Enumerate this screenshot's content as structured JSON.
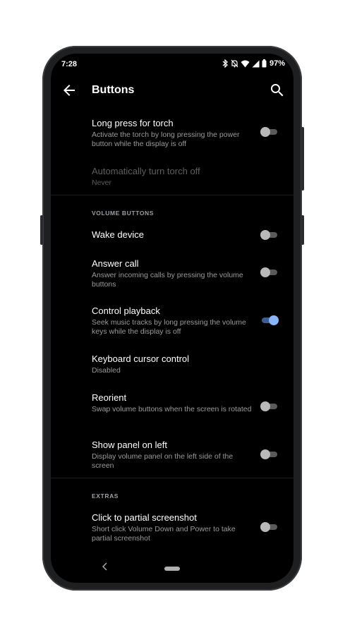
{
  "status_bar": {
    "time": "7:28",
    "battery": "97%"
  },
  "app_bar": {
    "title": "Buttons"
  },
  "settings": {
    "torch": {
      "title": "Long press for torch",
      "subtitle": "Activate the torch by long pressing the power button while the display is off",
      "enabled": false
    },
    "torch_off": {
      "title": "Automatically turn torch off",
      "subtitle": "Never"
    },
    "volume_header": "VOLUME BUTTONS",
    "wake_device": {
      "title": "Wake device",
      "enabled": false
    },
    "answer_call": {
      "title": "Answer call",
      "subtitle": "Answer incoming calls by pressing the volume buttons",
      "enabled": false
    },
    "control_playback": {
      "title": "Control playback",
      "subtitle": "Seek music tracks by long pressing the volume keys while the display is off",
      "enabled": true
    },
    "cursor_control": {
      "title": "Keyboard cursor control",
      "subtitle": "Disabled"
    },
    "reorient": {
      "title": "Reorient",
      "subtitle": "Swap volume buttons when the screen is rotated",
      "enabled": false
    },
    "panel_left": {
      "title": "Show panel on left",
      "subtitle": "Display volume panel on the left side of the screen",
      "enabled": false
    },
    "extras_header": "EXTRAS",
    "partial_screenshot": {
      "title": "Click to partial screenshot",
      "subtitle": "Short click Volume Down and Power to take partial screenshot",
      "enabled": false
    }
  },
  "colors": {
    "accent": "#8ab4f8",
    "background": "#000000"
  },
  "icons": [
    "arrow-back-icon",
    "search-icon",
    "bluetooth-icon",
    "mute-icon",
    "wifi-icon",
    "signal-icon",
    "battery-icon",
    "nav-back-icon",
    "home-pill-icon"
  ]
}
